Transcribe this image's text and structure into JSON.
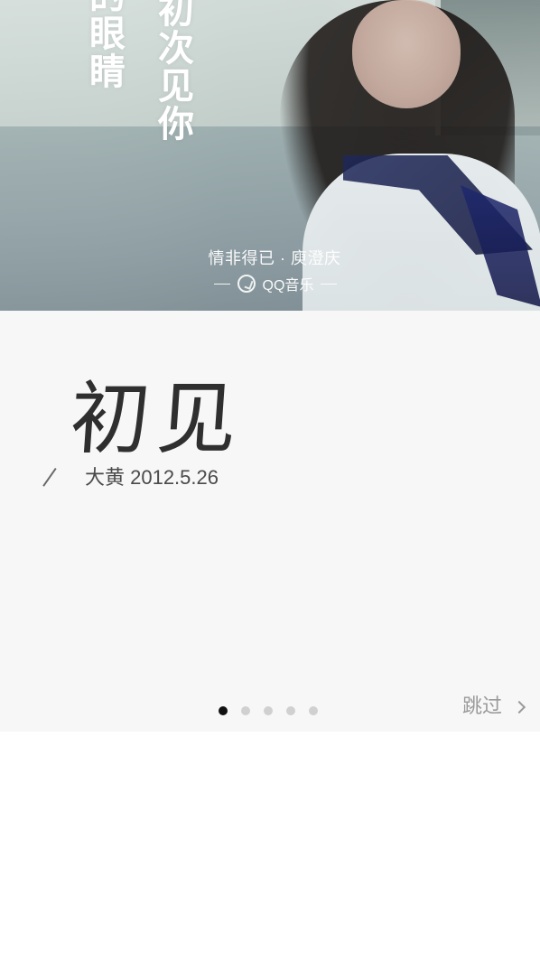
{
  "hero": {
    "vertical_title_col1": "的眼睛",
    "vertical_title_col2": "初次见你",
    "song_credit": "情非得已 · 庾澄庆",
    "brand_label": "QQ音乐"
  },
  "card": {
    "title": "初见",
    "meta": "大黄 2012.5.26"
  },
  "pager": {
    "total": 5,
    "active_index": 0
  },
  "actions": {
    "skip_label": "跳过"
  },
  "icons": {
    "brand_icon": "qq-music-icon",
    "chevron": "chevron-right-icon",
    "slash": "slash-icon"
  }
}
